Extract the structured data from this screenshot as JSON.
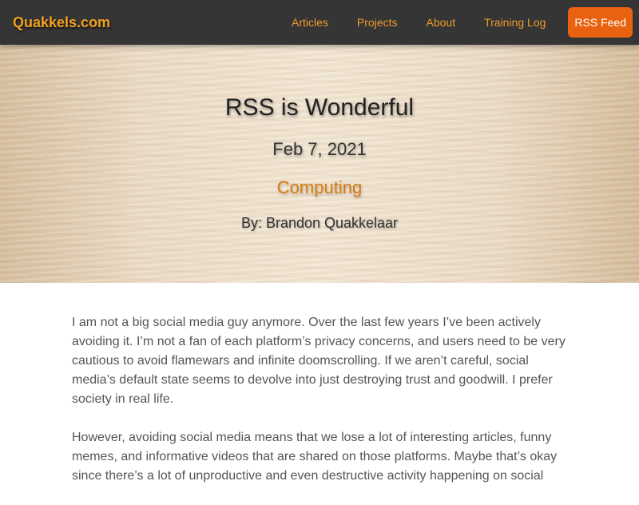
{
  "site": {
    "brand": "Quakkels.com"
  },
  "nav": {
    "links": [
      "Articles",
      "Projects",
      "About",
      "Training Log"
    ],
    "button": "RSS Feed"
  },
  "post": {
    "title": "RSS is Wonderful",
    "date": "Feb 7, 2021",
    "category": "Computing",
    "author": "By: Brandon Quakkelaar",
    "paragraphs": [
      "I am not a big social media guy anymore. Over the last few years I’ve been actively avoiding it. I’m not a fan of each platform’s privacy concerns, and users need to be very cautious to avoid flamewars and infinite doomscrolling. If we aren’t careful, social media’s default state seems to devolve into just destroying trust and goodwill. I prefer society in real life.",
      "However, avoiding social media means that we lose a lot of interesting articles, funny memes, and informative videos that are shared on those platforms. Maybe that’s okay since there’s a lot of unproductive and even destructive activity happening on social"
    ]
  },
  "colors": {
    "navbar_bg": "#353535",
    "brand": "#f0a020",
    "nav_link": "#ee9a2e",
    "nav_button_bg": "#e8620f",
    "category": "#d77a10",
    "body_text": "#555555"
  }
}
